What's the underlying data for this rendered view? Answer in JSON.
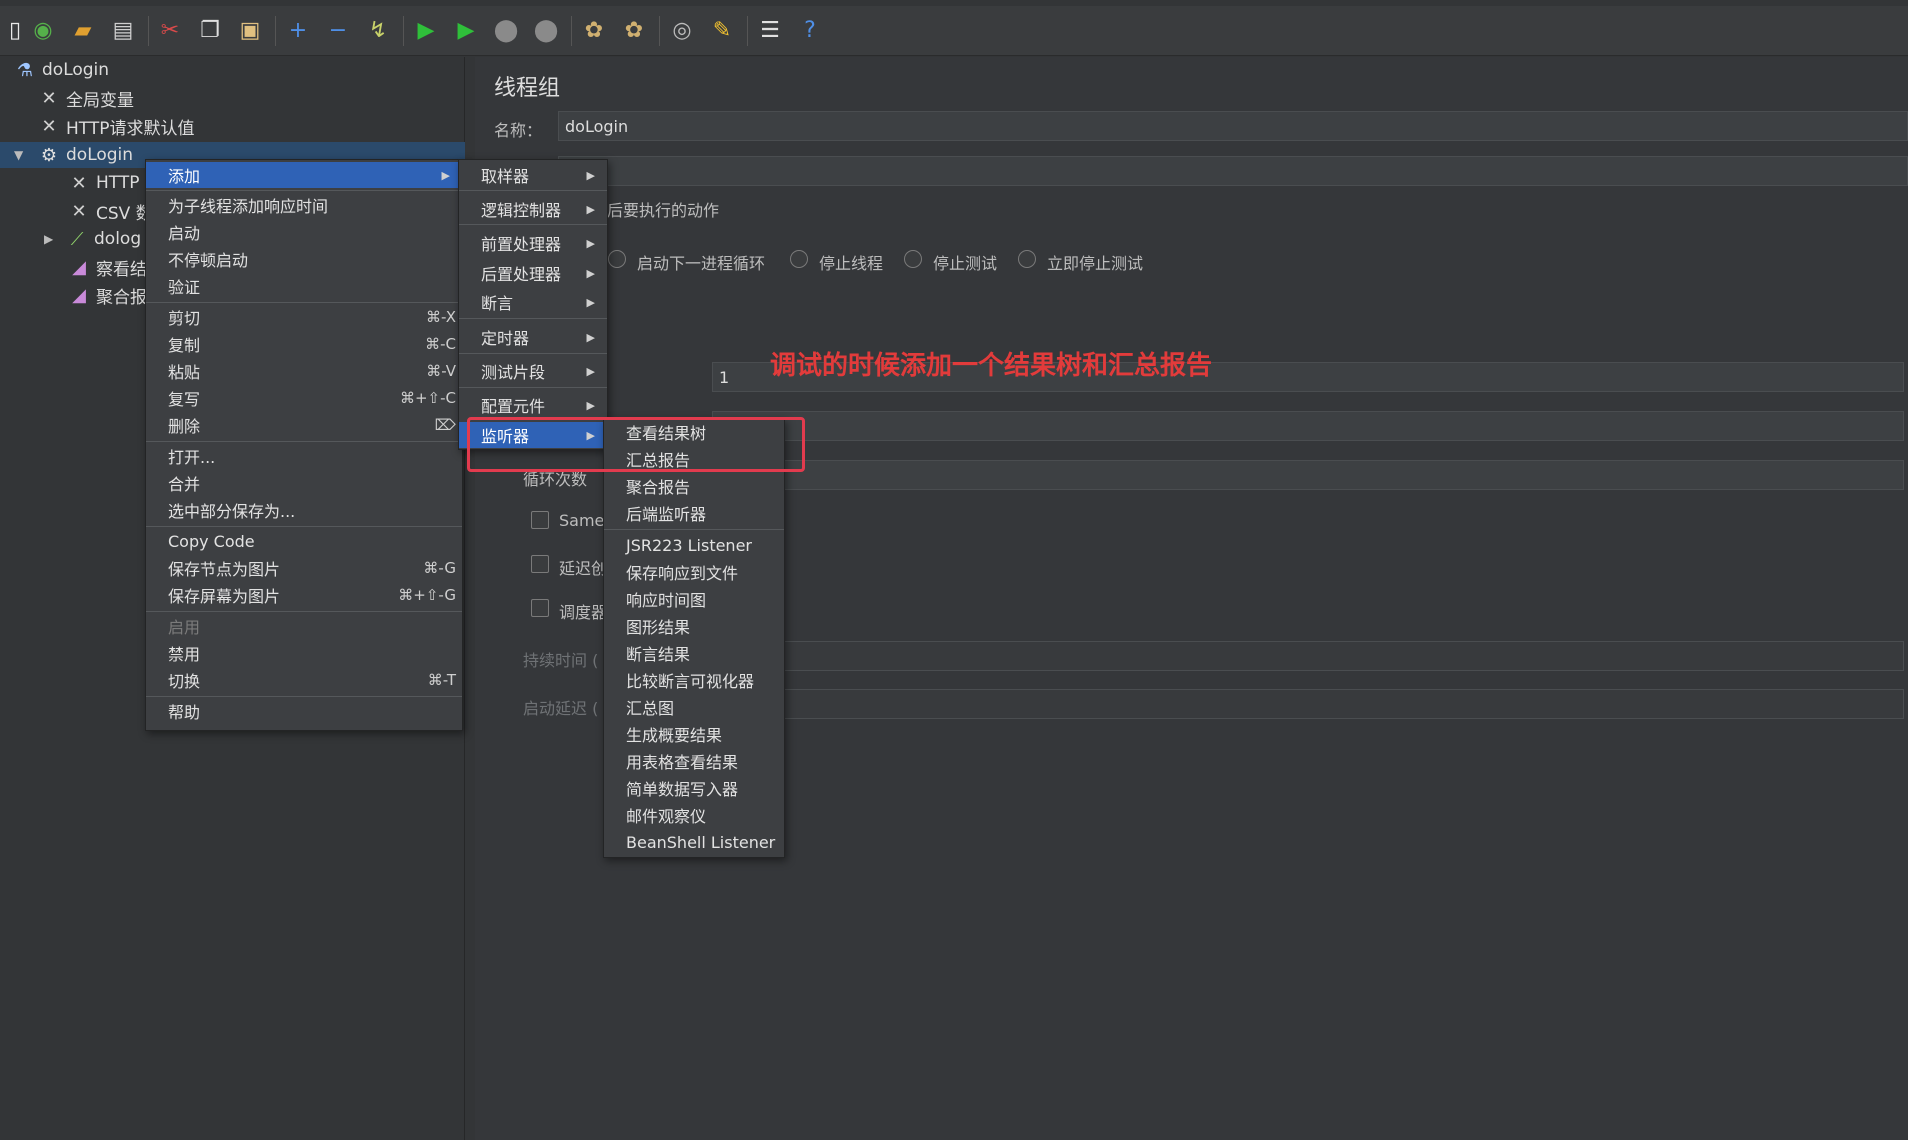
{
  "toolbar": {
    "icons": [
      "new-icon",
      "templates-icon",
      "open-icon",
      "save-icon",
      "cut-icon",
      "copy-icon",
      "paste-icon",
      "expand-icon",
      "collapse-icon",
      "toggle-icon",
      "start-icon",
      "start-no-pause-icon",
      "stop-icon",
      "shutdown-icon",
      "clear-icon",
      "clear-all-icon",
      "search-icon",
      "reset-search-icon",
      "function-helper-icon",
      "help-icon"
    ]
  },
  "tree": {
    "root": "doLogin",
    "items": [
      {
        "label": "全局变量"
      },
      {
        "label": "HTTP请求默认值"
      },
      {
        "label": "doLogin"
      },
      {
        "label": "HTTP"
      },
      {
        "label": "CSV 数"
      },
      {
        "label": "dolog"
      },
      {
        "label": "察看结"
      },
      {
        "label": "聚合报"
      }
    ]
  },
  "panel": {
    "title": "线程组",
    "name_label": "名称：",
    "name_value": "doLogin",
    "action_label": "后要执行的动作",
    "radios": [
      "启动下一进程循环",
      "停止线程",
      "停止测试",
      "立即停止测试"
    ],
    "threads_value": "1",
    "loop_label": "循环次数",
    "checkbox_same": "Same",
    "checkbox_delay": "延迟创",
    "checkbox_scheduler": "调度器",
    "duration_label": "持续时间 (",
    "startup_delay_label": "启动延迟 ("
  },
  "annotation": "调试的时候添加一个结果树和汇总报告",
  "context_menu": {
    "items": [
      {
        "label": "添加",
        "shortcut": ""
      },
      {
        "label": "为子线程添加响应时间",
        "shortcut": ""
      },
      {
        "label": "启动",
        "shortcut": ""
      },
      {
        "label": "不停顿启动",
        "shortcut": ""
      },
      {
        "label": "验证",
        "shortcut": ""
      },
      {
        "label": "剪切",
        "shortcut": "⌘-X"
      },
      {
        "label": "复制",
        "shortcut": "⌘-C"
      },
      {
        "label": "粘贴",
        "shortcut": "⌘-V"
      },
      {
        "label": "复写",
        "shortcut": "⌘+⇧-C"
      },
      {
        "label": "删除",
        "shortcut": "⌦"
      },
      {
        "label": "打开...",
        "shortcut": ""
      },
      {
        "label": "合并",
        "shortcut": ""
      },
      {
        "label": "选中部分保存为...",
        "shortcut": ""
      },
      {
        "label": "Copy Code",
        "shortcut": ""
      },
      {
        "label": "保存节点为图片",
        "shortcut": "⌘-G"
      },
      {
        "label": "保存屏幕为图片",
        "shortcut": "⌘+⇧-G"
      },
      {
        "label": "启用",
        "shortcut": ""
      },
      {
        "label": "禁用",
        "shortcut": ""
      },
      {
        "label": "切换",
        "shortcut": "⌘-T"
      },
      {
        "label": "帮助",
        "shortcut": ""
      }
    ]
  },
  "add_submenu": {
    "items": [
      "取样器",
      "逻辑控制器",
      "前置处理器",
      "后置处理器",
      "断言",
      "定时器",
      "测试片段",
      "配置元件",
      "监听器"
    ]
  },
  "listener_submenu": {
    "items": [
      "查看结果树",
      "汇总报告",
      "聚合报告",
      "后端监听器",
      "JSR223 Listener",
      "保存响应到文件",
      "响应时间图",
      "图形结果",
      "断言结果",
      "比较断言可视化器",
      "汇总图",
      "生成概要结果",
      "用表格查看结果",
      "简单数据写入器",
      "邮件观察仪",
      "BeanShell Listener"
    ]
  },
  "colors": {
    "highlight": "#2f62b6",
    "annotation": "#e23b3b",
    "background": "#333537"
  }
}
